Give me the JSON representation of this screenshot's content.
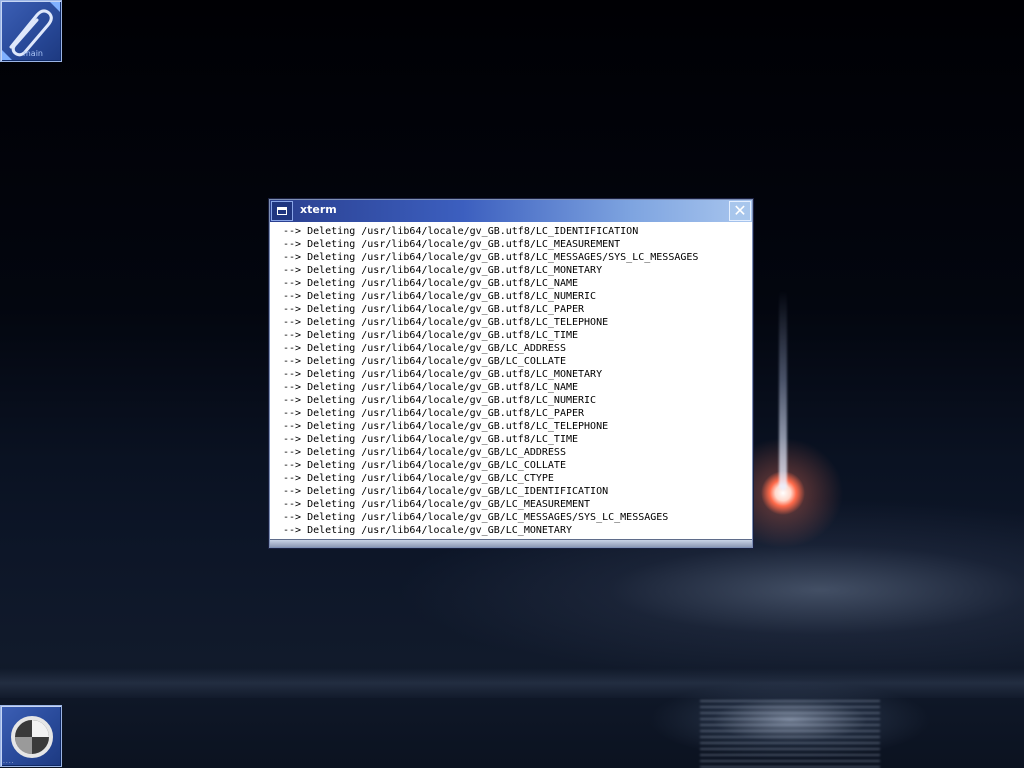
{
  "desktop": {
    "top_icon": {
      "caption": "main",
      "icon": "paperclip-icon"
    },
    "bottom_icon": {
      "caption": "....",
      "icon": "clock-icon"
    }
  },
  "window": {
    "title": "xterm",
    "menu_icon": "window-menu-icon",
    "close_label": "✕",
    "lines": [
      "--> Deleting /usr/lib64/locale/gv_GB.utf8/LC_IDENTIFICATION",
      "--> Deleting /usr/lib64/locale/gv_GB.utf8/LC_MEASUREMENT",
      "--> Deleting /usr/lib64/locale/gv_GB.utf8/LC_MESSAGES/SYS_LC_MESSAGES",
      "--> Deleting /usr/lib64/locale/gv_GB.utf8/LC_MONETARY",
      "--> Deleting /usr/lib64/locale/gv_GB.utf8/LC_NAME",
      "--> Deleting /usr/lib64/locale/gv_GB.utf8/LC_NUMERIC",
      "--> Deleting /usr/lib64/locale/gv_GB.utf8/LC_PAPER",
      "--> Deleting /usr/lib64/locale/gv_GB.utf8/LC_TELEPHONE",
      "--> Deleting /usr/lib64/locale/gv_GB.utf8/LC_TIME",
      "--> Deleting /usr/lib64/locale/gv_GB/LC_ADDRESS",
      "--> Deleting /usr/lib64/locale/gv_GB/LC_COLLATE",
      "--> Deleting /usr/lib64/locale/gv_GB.utf8/LC_MONETARY",
      "--> Deleting /usr/lib64/locale/gv_GB.utf8/LC_NAME",
      "--> Deleting /usr/lib64/locale/gv_GB.utf8/LC_NUMERIC",
      "--> Deleting /usr/lib64/locale/gv_GB.utf8/LC_PAPER",
      "--> Deleting /usr/lib64/locale/gv_GB.utf8/LC_TELEPHONE",
      "--> Deleting /usr/lib64/locale/gv_GB.utf8/LC_TIME",
      "--> Deleting /usr/lib64/locale/gv_GB/LC_ADDRESS",
      "--> Deleting /usr/lib64/locale/gv_GB/LC_COLLATE",
      "--> Deleting /usr/lib64/locale/gv_GB/LC_CTYPE",
      "--> Deleting /usr/lib64/locale/gv_GB/LC_IDENTIFICATION",
      "--> Deleting /usr/lib64/locale/gv_GB/LC_MEASUREMENT",
      "--> Deleting /usr/lib64/locale/gv_GB/LC_MESSAGES/SYS_LC_MESSAGES",
      "--> Deleting /usr/lib64/locale/gv_GB/LC_MONETARY"
    ]
  },
  "colors": {
    "titlebar_start": "#2a3f8f",
    "titlebar_end": "#a9c6ee",
    "terminal_bg": "#ffffff",
    "terminal_fg": "#000000"
  }
}
